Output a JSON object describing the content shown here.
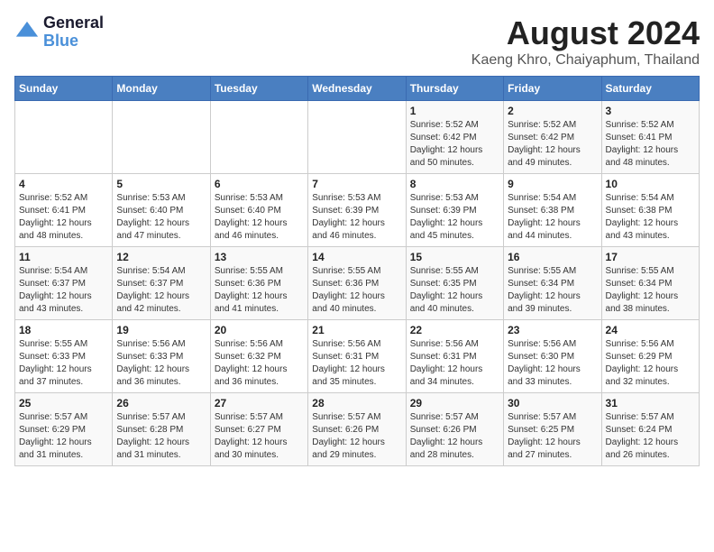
{
  "app": {
    "name": "GeneralBlue",
    "logo_text_general": "General",
    "logo_text_blue": "Blue"
  },
  "header": {
    "title": "August 2024",
    "subtitle": "Kaeng Khro, Chaiyaphum, Thailand"
  },
  "days_of_week": [
    "Sunday",
    "Monday",
    "Tuesday",
    "Wednesday",
    "Thursday",
    "Friday",
    "Saturday"
  ],
  "weeks": [
    [
      {
        "day": "",
        "info": ""
      },
      {
        "day": "",
        "info": ""
      },
      {
        "day": "",
        "info": ""
      },
      {
        "day": "",
        "info": ""
      },
      {
        "day": "1",
        "info": "Sunrise: 5:52 AM\nSunset: 6:42 PM\nDaylight: 12 hours\nand 50 minutes."
      },
      {
        "day": "2",
        "info": "Sunrise: 5:52 AM\nSunset: 6:42 PM\nDaylight: 12 hours\nand 49 minutes."
      },
      {
        "day": "3",
        "info": "Sunrise: 5:52 AM\nSunset: 6:41 PM\nDaylight: 12 hours\nand 48 minutes."
      }
    ],
    [
      {
        "day": "4",
        "info": "Sunrise: 5:52 AM\nSunset: 6:41 PM\nDaylight: 12 hours\nand 48 minutes."
      },
      {
        "day": "5",
        "info": "Sunrise: 5:53 AM\nSunset: 6:40 PM\nDaylight: 12 hours\nand 47 minutes."
      },
      {
        "day": "6",
        "info": "Sunrise: 5:53 AM\nSunset: 6:40 PM\nDaylight: 12 hours\nand 46 minutes."
      },
      {
        "day": "7",
        "info": "Sunrise: 5:53 AM\nSunset: 6:39 PM\nDaylight: 12 hours\nand 46 minutes."
      },
      {
        "day": "8",
        "info": "Sunrise: 5:53 AM\nSunset: 6:39 PM\nDaylight: 12 hours\nand 45 minutes."
      },
      {
        "day": "9",
        "info": "Sunrise: 5:54 AM\nSunset: 6:38 PM\nDaylight: 12 hours\nand 44 minutes."
      },
      {
        "day": "10",
        "info": "Sunrise: 5:54 AM\nSunset: 6:38 PM\nDaylight: 12 hours\nand 43 minutes."
      }
    ],
    [
      {
        "day": "11",
        "info": "Sunrise: 5:54 AM\nSunset: 6:37 PM\nDaylight: 12 hours\nand 43 minutes."
      },
      {
        "day": "12",
        "info": "Sunrise: 5:54 AM\nSunset: 6:37 PM\nDaylight: 12 hours\nand 42 minutes."
      },
      {
        "day": "13",
        "info": "Sunrise: 5:55 AM\nSunset: 6:36 PM\nDaylight: 12 hours\nand 41 minutes."
      },
      {
        "day": "14",
        "info": "Sunrise: 5:55 AM\nSunset: 6:36 PM\nDaylight: 12 hours\nand 40 minutes."
      },
      {
        "day": "15",
        "info": "Sunrise: 5:55 AM\nSunset: 6:35 PM\nDaylight: 12 hours\nand 40 minutes."
      },
      {
        "day": "16",
        "info": "Sunrise: 5:55 AM\nSunset: 6:34 PM\nDaylight: 12 hours\nand 39 minutes."
      },
      {
        "day": "17",
        "info": "Sunrise: 5:55 AM\nSunset: 6:34 PM\nDaylight: 12 hours\nand 38 minutes."
      }
    ],
    [
      {
        "day": "18",
        "info": "Sunrise: 5:55 AM\nSunset: 6:33 PM\nDaylight: 12 hours\nand 37 minutes."
      },
      {
        "day": "19",
        "info": "Sunrise: 5:56 AM\nSunset: 6:33 PM\nDaylight: 12 hours\nand 36 minutes."
      },
      {
        "day": "20",
        "info": "Sunrise: 5:56 AM\nSunset: 6:32 PM\nDaylight: 12 hours\nand 36 minutes."
      },
      {
        "day": "21",
        "info": "Sunrise: 5:56 AM\nSunset: 6:31 PM\nDaylight: 12 hours\nand 35 minutes."
      },
      {
        "day": "22",
        "info": "Sunrise: 5:56 AM\nSunset: 6:31 PM\nDaylight: 12 hours\nand 34 minutes."
      },
      {
        "day": "23",
        "info": "Sunrise: 5:56 AM\nSunset: 6:30 PM\nDaylight: 12 hours\nand 33 minutes."
      },
      {
        "day": "24",
        "info": "Sunrise: 5:56 AM\nSunset: 6:29 PM\nDaylight: 12 hours\nand 32 minutes."
      }
    ],
    [
      {
        "day": "25",
        "info": "Sunrise: 5:57 AM\nSunset: 6:29 PM\nDaylight: 12 hours\nand 31 minutes."
      },
      {
        "day": "26",
        "info": "Sunrise: 5:57 AM\nSunset: 6:28 PM\nDaylight: 12 hours\nand 31 minutes."
      },
      {
        "day": "27",
        "info": "Sunrise: 5:57 AM\nSunset: 6:27 PM\nDaylight: 12 hours\nand 30 minutes."
      },
      {
        "day": "28",
        "info": "Sunrise: 5:57 AM\nSunset: 6:26 PM\nDaylight: 12 hours\nand 29 minutes."
      },
      {
        "day": "29",
        "info": "Sunrise: 5:57 AM\nSunset: 6:26 PM\nDaylight: 12 hours\nand 28 minutes."
      },
      {
        "day": "30",
        "info": "Sunrise: 5:57 AM\nSunset: 6:25 PM\nDaylight: 12 hours\nand 27 minutes."
      },
      {
        "day": "31",
        "info": "Sunrise: 5:57 AM\nSunset: 6:24 PM\nDaylight: 12 hours\nand 26 minutes."
      }
    ]
  ]
}
